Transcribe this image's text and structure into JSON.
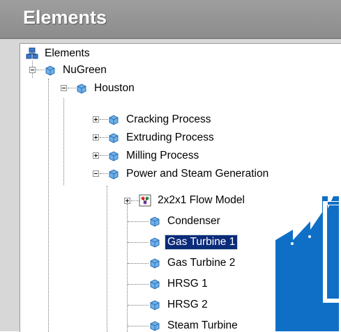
{
  "panel": {
    "title": "Elements"
  },
  "tree": {
    "root": {
      "label": "Elements",
      "icon": "elements-root-icon"
    },
    "nodes": [
      {
        "label": "NuGreen",
        "icon": "element-cube-icon"
      },
      {
        "label": "Houston",
        "icon": "element-cube-icon"
      },
      {
        "label": "Cracking Process",
        "icon": "element-cube-icon"
      },
      {
        "label": "Extruding Process",
        "icon": "element-cube-icon"
      },
      {
        "label": "Milling Process",
        "icon": "element-cube-icon"
      },
      {
        "label": "Power and Steam Generation",
        "icon": "element-cube-icon"
      },
      {
        "label": "2x2x1 Flow Model",
        "icon": "flow-model-icon"
      },
      {
        "label": "Condenser",
        "icon": "element-cube-icon"
      },
      {
        "label": "Gas Turbine 1",
        "icon": "element-cube-icon",
        "selected": true
      },
      {
        "label": "Gas Turbine 2",
        "icon": "element-cube-icon"
      },
      {
        "label": "HRSG 1",
        "icon": "element-cube-icon"
      },
      {
        "label": "HRSG 2",
        "icon": "element-cube-icon"
      },
      {
        "label": "Steam Turbine",
        "icon": "element-cube-icon"
      }
    ]
  },
  "colors": {
    "accent": "#0f6fc6",
    "selection": "#0b2a7a",
    "header": "#959595"
  }
}
